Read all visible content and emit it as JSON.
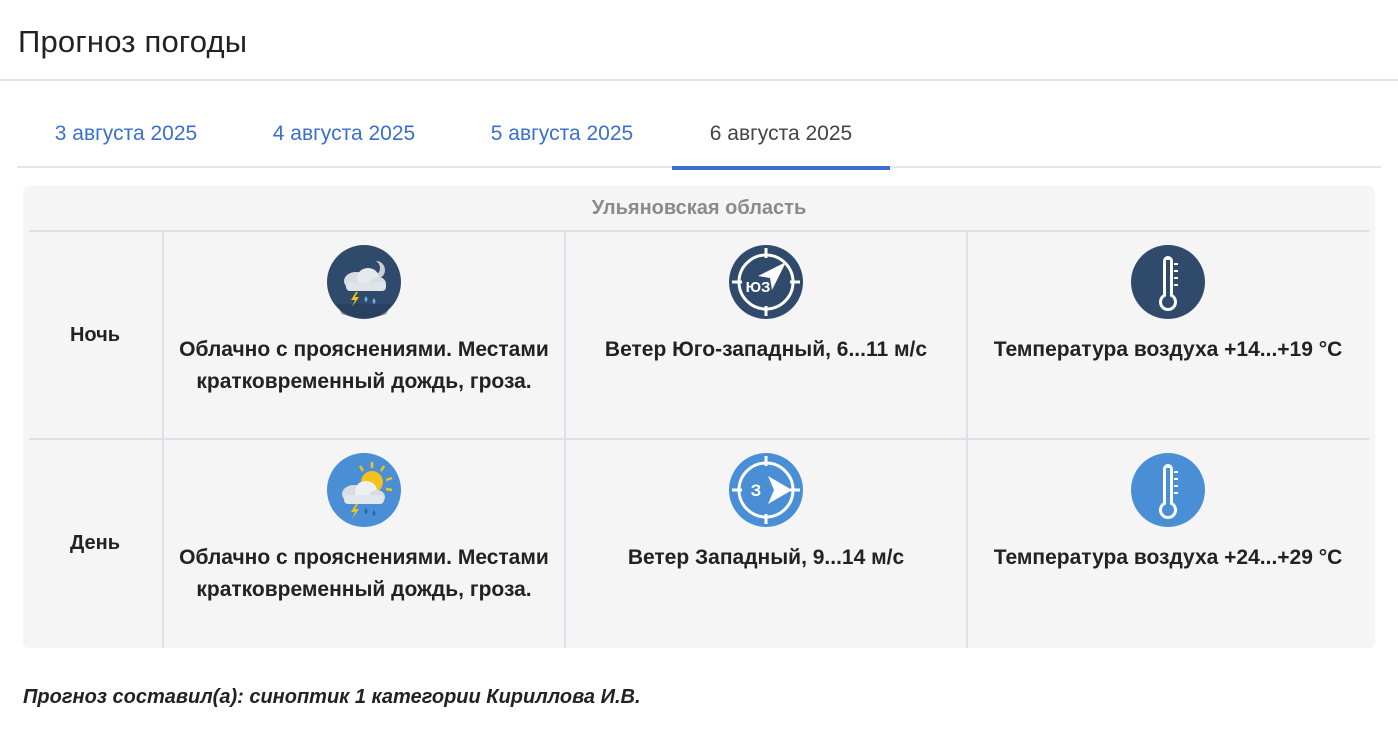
{
  "page": {
    "title": "Прогноз погоды"
  },
  "tabs": [
    {
      "label": "3 августа 2025"
    },
    {
      "label": "4 августа 2025"
    },
    {
      "label": "5 августа 2025"
    },
    {
      "label": "6 августа 2025",
      "active": true
    }
  ],
  "forecast": {
    "region": "Ульяновская область",
    "rows": [
      {
        "period": "Ночь",
        "weather": {
          "icon": "night-cloud-thunder-rain-icon",
          "text": "Облачно с прояснениями. Местами кратковременный дождь, гроза."
        },
        "wind": {
          "icon": "wind-southwest-icon",
          "direction_code": "ЮЗ",
          "text": "Ветер Юго-западный, 6...11 м/с"
        },
        "temperature": {
          "icon": "thermometer-icon",
          "text": "Температура воздуха +14...+19 °С"
        }
      },
      {
        "period": "День",
        "weather": {
          "icon": "day-sun-cloud-thunder-rain-icon",
          "text": "Облачно с прояснениями. Местами кратковременный дождь, гроза."
        },
        "wind": {
          "icon": "wind-west-icon",
          "direction_code": "З",
          "text": "Ветер Западный, 9...14 м/с"
        },
        "temperature": {
          "icon": "thermometer-icon",
          "text": "Температура воздуха +24...+29 °С"
        }
      }
    ]
  },
  "footer": {
    "note": "Прогноз составил(а): синоптик 1 категории Кириллова И.В."
  },
  "colors": {
    "link": "#3a6fcf",
    "night_icon_bg": "#2f4a6b",
    "day_icon_bg": "#4a8fd6",
    "card_bg": "#f5f5f5"
  }
}
